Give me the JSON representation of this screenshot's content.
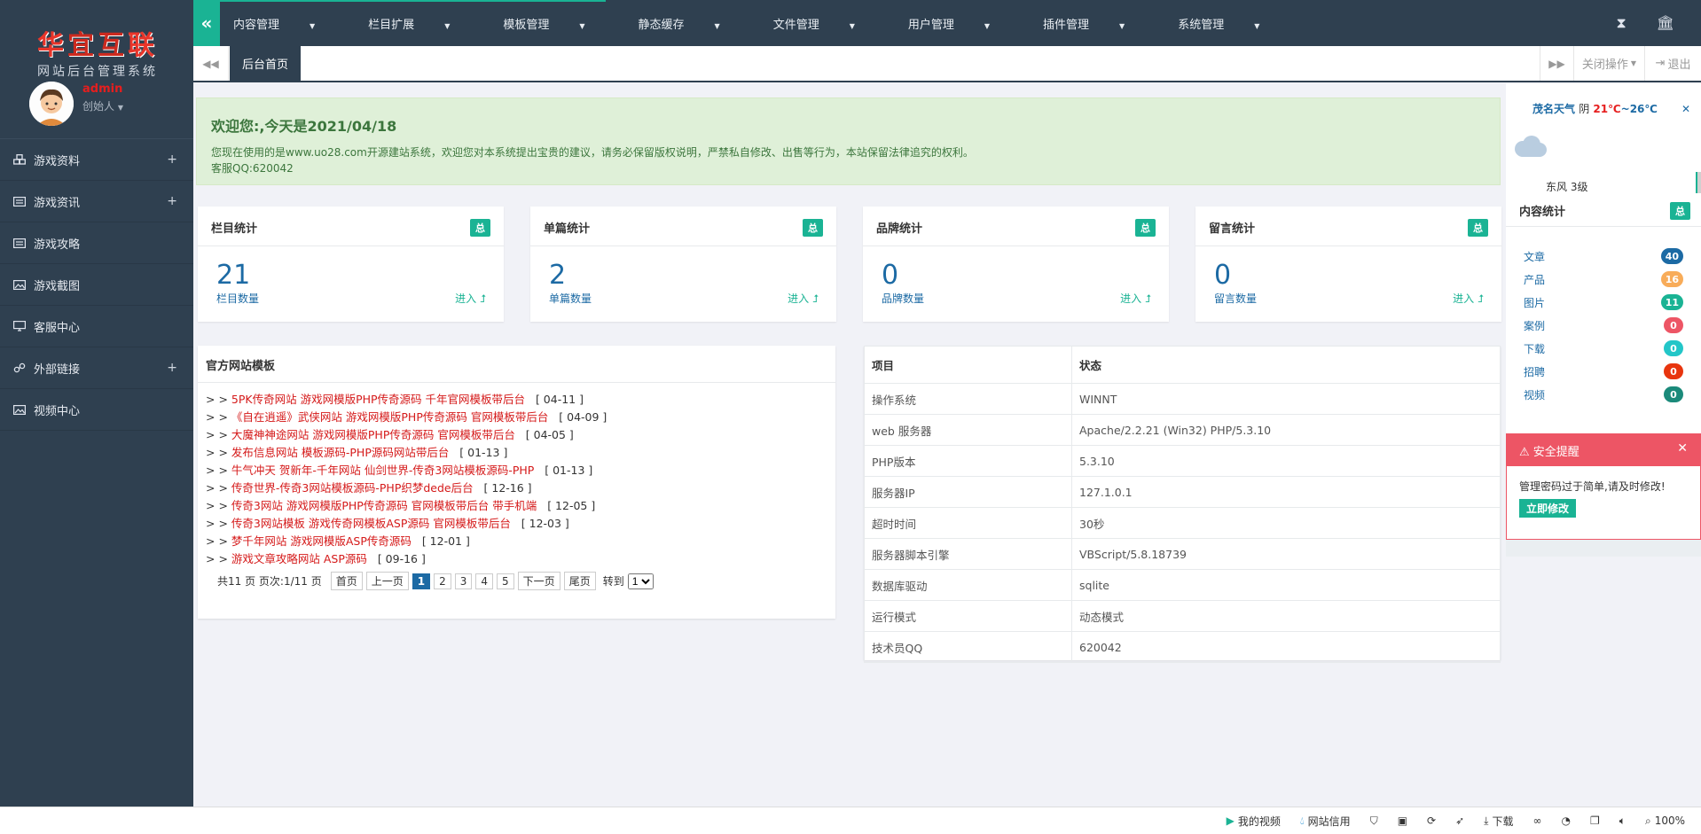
{
  "brand": {
    "logo_text": "华宜互联",
    "subtitle": "网站后台管理系统"
  },
  "user": {
    "name": "admin",
    "role": "创始人"
  },
  "sidebar": {
    "items": [
      {
        "label": "游戏资料",
        "icon": "cubes-icon",
        "expandable": "+"
      },
      {
        "label": "游戏资讯",
        "icon": "newspaper-icon",
        "expandable": "+"
      },
      {
        "label": "游戏攻略",
        "icon": "newspaper-icon",
        "expandable": ""
      },
      {
        "label": "游戏截图",
        "icon": "image-icon",
        "expandable": ""
      },
      {
        "label": "客服中心",
        "icon": "monitor-icon",
        "expandable": ""
      },
      {
        "label": "外部链接",
        "icon": "link-icon",
        "expandable": "+"
      },
      {
        "label": "视频中心",
        "icon": "image-icon",
        "expandable": ""
      }
    ]
  },
  "topnav": {
    "items": [
      "内容管理",
      "栏目扩展",
      "模板管理",
      "静态缓存",
      "文件管理",
      "用户管理",
      "插件管理",
      "系统管理"
    ]
  },
  "tabs": {
    "active": "后台首页",
    "close_ops": "关闭操作",
    "exit": "退出"
  },
  "welcome": {
    "title": "欢迎您:,今天是2021/04/18",
    "line1": "您现在使用的是www.uo28.com开源建站系统，欢迎您对本系统提出宝贵的建议，请务必保留版权说明，严禁私自修改、出售等行为，本站保留法律追究的权利。",
    "line2": "客服QQ:620042"
  },
  "stats": [
    {
      "title": "栏目统计",
      "badge": "总",
      "value": "21",
      "label": "栏目数量",
      "enter": "进入"
    },
    {
      "title": "单篇统计",
      "badge": "总",
      "value": "2",
      "label": "单篇数量",
      "enter": "进入"
    },
    {
      "title": "品牌统计",
      "badge": "总",
      "value": "0",
      "label": "品牌数量",
      "enter": "进入"
    },
    {
      "title": "留言统计",
      "badge": "总",
      "value": "0",
      "label": "留言数量",
      "enter": "进入"
    }
  ],
  "templates": {
    "title": "官方网站模板",
    "items": [
      {
        "text": "5PK传奇网站 游戏网模版PHP传奇源码 千年官网模板带后台",
        "date": "[ 04-11 ]"
      },
      {
        "text": "《自在逍遥》武侠网站 游戏网模版PHP传奇源码 官网模板带后台",
        "date": "[ 04-09 ]"
      },
      {
        "text": "大魔神神途网站 游戏网模版PHP传奇源码 官网模板带后台",
        "date": "[ 04-05 ]"
      },
      {
        "text": "发布信息网站 模板源码-PHP源码网站带后台",
        "date": "[ 01-13 ]"
      },
      {
        "text": "牛气冲天 贺新年-千年网站 仙剑世界-传奇3网站模板源码-PHP",
        "date": "[ 01-13 ]"
      },
      {
        "text": "传奇世界-传奇3网站模板源码-PHP织梦dede后台",
        "date": "[ 12-16 ]"
      },
      {
        "text": "传奇3网站 游戏网模版PHP传奇源码 官网模板带后台 带手机端",
        "date": "[ 12-05 ]"
      },
      {
        "text": "传奇3网站模板 游戏传奇网模板ASP源码 官网模板带后台",
        "date": "[ 12-03 ]"
      },
      {
        "text": "梦千年网站 游戏网模版ASP传奇源码",
        "date": "[ 12-01 ]"
      },
      {
        "text": "游戏文章攻略网站 ASP源码",
        "date": "[ 09-16 ]"
      }
    ],
    "pager": {
      "summary": "共11 页 页次:1/11 页",
      "first": "首页",
      "prev": "上一页",
      "pages": [
        "1",
        "2",
        "3",
        "4",
        "5"
      ],
      "next": "下一页",
      "last": "尾页",
      "goto": "转到",
      "goto_value": "1"
    }
  },
  "server": {
    "headers": [
      "项目",
      "状态"
    ],
    "rows": [
      [
        "操作系统",
        "WINNT"
      ],
      [
        "web 服务器",
        "Apache/2.2.21 (Win32) PHP/5.3.10"
      ],
      [
        "PHP版本",
        "5.3.10"
      ],
      [
        "服务器IP",
        "127.1.0.1"
      ],
      [
        "超时时间",
        "30秒"
      ],
      [
        "服务器脚本引擎",
        "VBScript/5.8.18739"
      ],
      [
        "数据库驱动",
        "sqlite"
      ],
      [
        "运行模式",
        "动态模式"
      ],
      [
        "技术员QQ",
        "620042"
      ]
    ]
  },
  "weather": {
    "city": "茂名天气",
    "cond": "阴",
    "low": "21℃",
    "sep": "~",
    "high": "26℃",
    "wind": "东风 3级"
  },
  "content_stats": {
    "title": "内容统计",
    "badge": "总",
    "items": [
      {
        "label": "文章",
        "value": "40",
        "color": "#1c6aa4"
      },
      {
        "label": "产品",
        "value": "16",
        "color": "#f8ac59"
      },
      {
        "label": "图片",
        "value": "11",
        "color": "#1ab394"
      },
      {
        "label": "案例",
        "value": "0",
        "color": "#ed5565"
      },
      {
        "label": "下载",
        "value": "0",
        "color": "#23c6c8"
      },
      {
        "label": "招聘",
        "value": "0",
        "color": "#e8350e"
      },
      {
        "label": "视频",
        "value": "0",
        "color": "#1b8a7a"
      }
    ]
  },
  "security": {
    "title": "安全提醒",
    "message": "管理密码过于简单,请及时修改!",
    "button": "立即修改"
  },
  "statusbar": {
    "video": "我的视频",
    "credit": "网站信用",
    "download": "下载",
    "zoom": "100%"
  },
  "colors": {
    "sidebar": "#2f4050",
    "accent": "#1ab394",
    "danger": "#ed5565",
    "link": "#1c6aa4"
  }
}
